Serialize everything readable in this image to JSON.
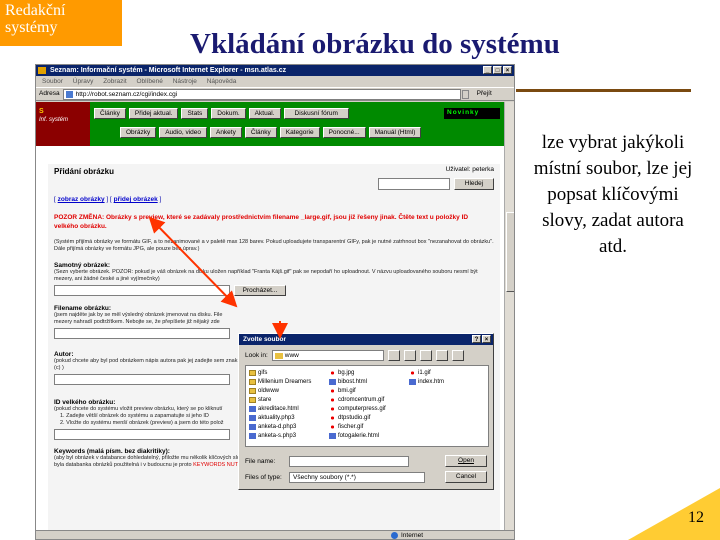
{
  "slide": {
    "logo_line1": "Redakční",
    "logo_line2": "systémy",
    "title": "Vkládání obrázku do systému",
    "description": "lze vybrat jakýkoli místní soubor, lze jej popsat klíčovými slovy, zadat autora atd.",
    "page_number": "12"
  },
  "browser": {
    "title": "Seznam: Informační systém - Microsoft Internet Explorer - msn.atlas.cz",
    "menu": [
      "Soubor",
      "Úpravy",
      "Zobrazit",
      "Oblíbené",
      "Nástroje",
      "Nápověda"
    ],
    "address_label": "Adresa",
    "url": "http://robot.seznam.cz/cgi/index.cgi",
    "go_label": "Přejít",
    "status": "Internet"
  },
  "site": {
    "logo_text": "Inf. systém",
    "nav_row1": [
      "Články",
      "Přidej aktual.",
      "Stats",
      "Dokum.",
      "Aktual.",
      "Diskusní fórum"
    ],
    "nav_row2": [
      "Obrázky",
      "Audio, video",
      "Ankety",
      "Články",
      "Kategorie",
      "Ponocné...",
      "Manuál (Html)"
    ],
    "news_select": "Novinky",
    "page_heading": "Přidání obrázku",
    "user_label": "Uživatel: peterka",
    "search_button": "Hledej",
    "crumb_link1": "zobraz obrázky",
    "crumb_link2": "přidej obrázek",
    "warning": "POZOR ZMĚNA: Obrázky s preview, které se zadávaly prostřednictvím filename _large.gif, jsou již řešeny jinak. Čtěte text u položky ID velkého obrázku.",
    "intro_note": "(Systém přijímá obrázky ve formátu GIF, a to nezanimované a v paletě max 128 barev. Pokud uploadujete transparentní GIFy, pak je nutné zatrhnout box \"nezanahovat do obrázku\". Dále přijímá obrázky ve formátu JPG, ale pouze bez úprav.)",
    "file_label": "Samotný obrázek:",
    "file_note": "(Sezn vyberte obrázek. POZOR: pokud je váš obrázek na disku uložen například \"Franta Kájš.gif\" pak se nepodaří ho uploadnout. V názvu uploadovaného souboru nesmí být mezery, ani žádné české a jiné vyjímečnky)",
    "browse_button": "Procházet...",
    "filename_label": "Filename obrázku:",
    "filename_note": "(jsem najděte jak by se měl výsledný obrázek jmenovat na disku. File mezery nahradí podtržítkem. Nebojte se, že přepíšete již nějaký zde",
    "author_label": "Autor:",
    "author_note": "(pokud chcete aby byl pod obrázkem nápis autora pak jej zadejte sem znak (c) )",
    "id_label": "ID velkého obrázku:",
    "id_note1": "(pokud chcete do systému vložit preview obrázku, který se po kliknutí",
    "id_note2": "1. Zadejte větší obrázek do systému a zapamatujte si jeho ID",
    "id_note3": "2. Vložte do systému menší obrázek (preview) a jsem do této polož",
    "keywords_label": "Keywords (malá písm. bez diakritiky):",
    "keywords_note": "(aby byl obrázek v databance dohledatelný, přiložte mu několik klíčových slov a to prosím malými písmeny a bez diakritiky, například takto: \"karel komarek politika parlament\". Aby byla databanka obrázků použitelná i v budoucnu je proto",
    "keywords_note_red": "KEYWORDS NUTNÉ VYPLNIT!)"
  },
  "dialog": {
    "title": "Zvolte soubor",
    "look_in_label": "Look in:",
    "look_in_value": "www",
    "files": [
      {
        "name": "gifs",
        "type": "folder"
      },
      {
        "name": "Millenium Dreamers",
        "type": "folder"
      },
      {
        "name": "oldwww",
        "type": "folder"
      },
      {
        "name": "stare",
        "type": "folder"
      },
      {
        "name": "akreditace.html",
        "type": "doc"
      },
      {
        "name": "aktuality.php3",
        "type": "doc"
      },
      {
        "name": "anketa-d.php3",
        "type": "doc"
      },
      {
        "name": "anketa-s.php3",
        "type": "doc"
      },
      {
        "name": "bg.jpg",
        "type": "img"
      },
      {
        "name": "bibost.html",
        "type": "doc"
      },
      {
        "name": "bmi.gif",
        "type": "img"
      },
      {
        "name": "cdromcentrum.gif",
        "type": "img"
      },
      {
        "name": "computerpress.gif",
        "type": "img"
      },
      {
        "name": "dtpstudio.gif",
        "type": "img"
      },
      {
        "name": "fischer.gif",
        "type": "img"
      },
      {
        "name": "fotogalerie.html",
        "type": "doc"
      },
      {
        "name": "i1.gif",
        "type": "img"
      },
      {
        "name": "index.htm",
        "type": "doc"
      }
    ],
    "file_name_label": "File name:",
    "file_name_value": "",
    "file_type_label": "Files of type:",
    "file_type_value": "Všechny soubory (*.*)",
    "open_button": "Open",
    "cancel_button": "Cancel"
  },
  "colors": {
    "slide_logo_bg": "#ff9a00",
    "slide_title": "#1a1a70",
    "site_header": "#008a00",
    "warning": "#e00000",
    "arrow": "#ff3300"
  }
}
